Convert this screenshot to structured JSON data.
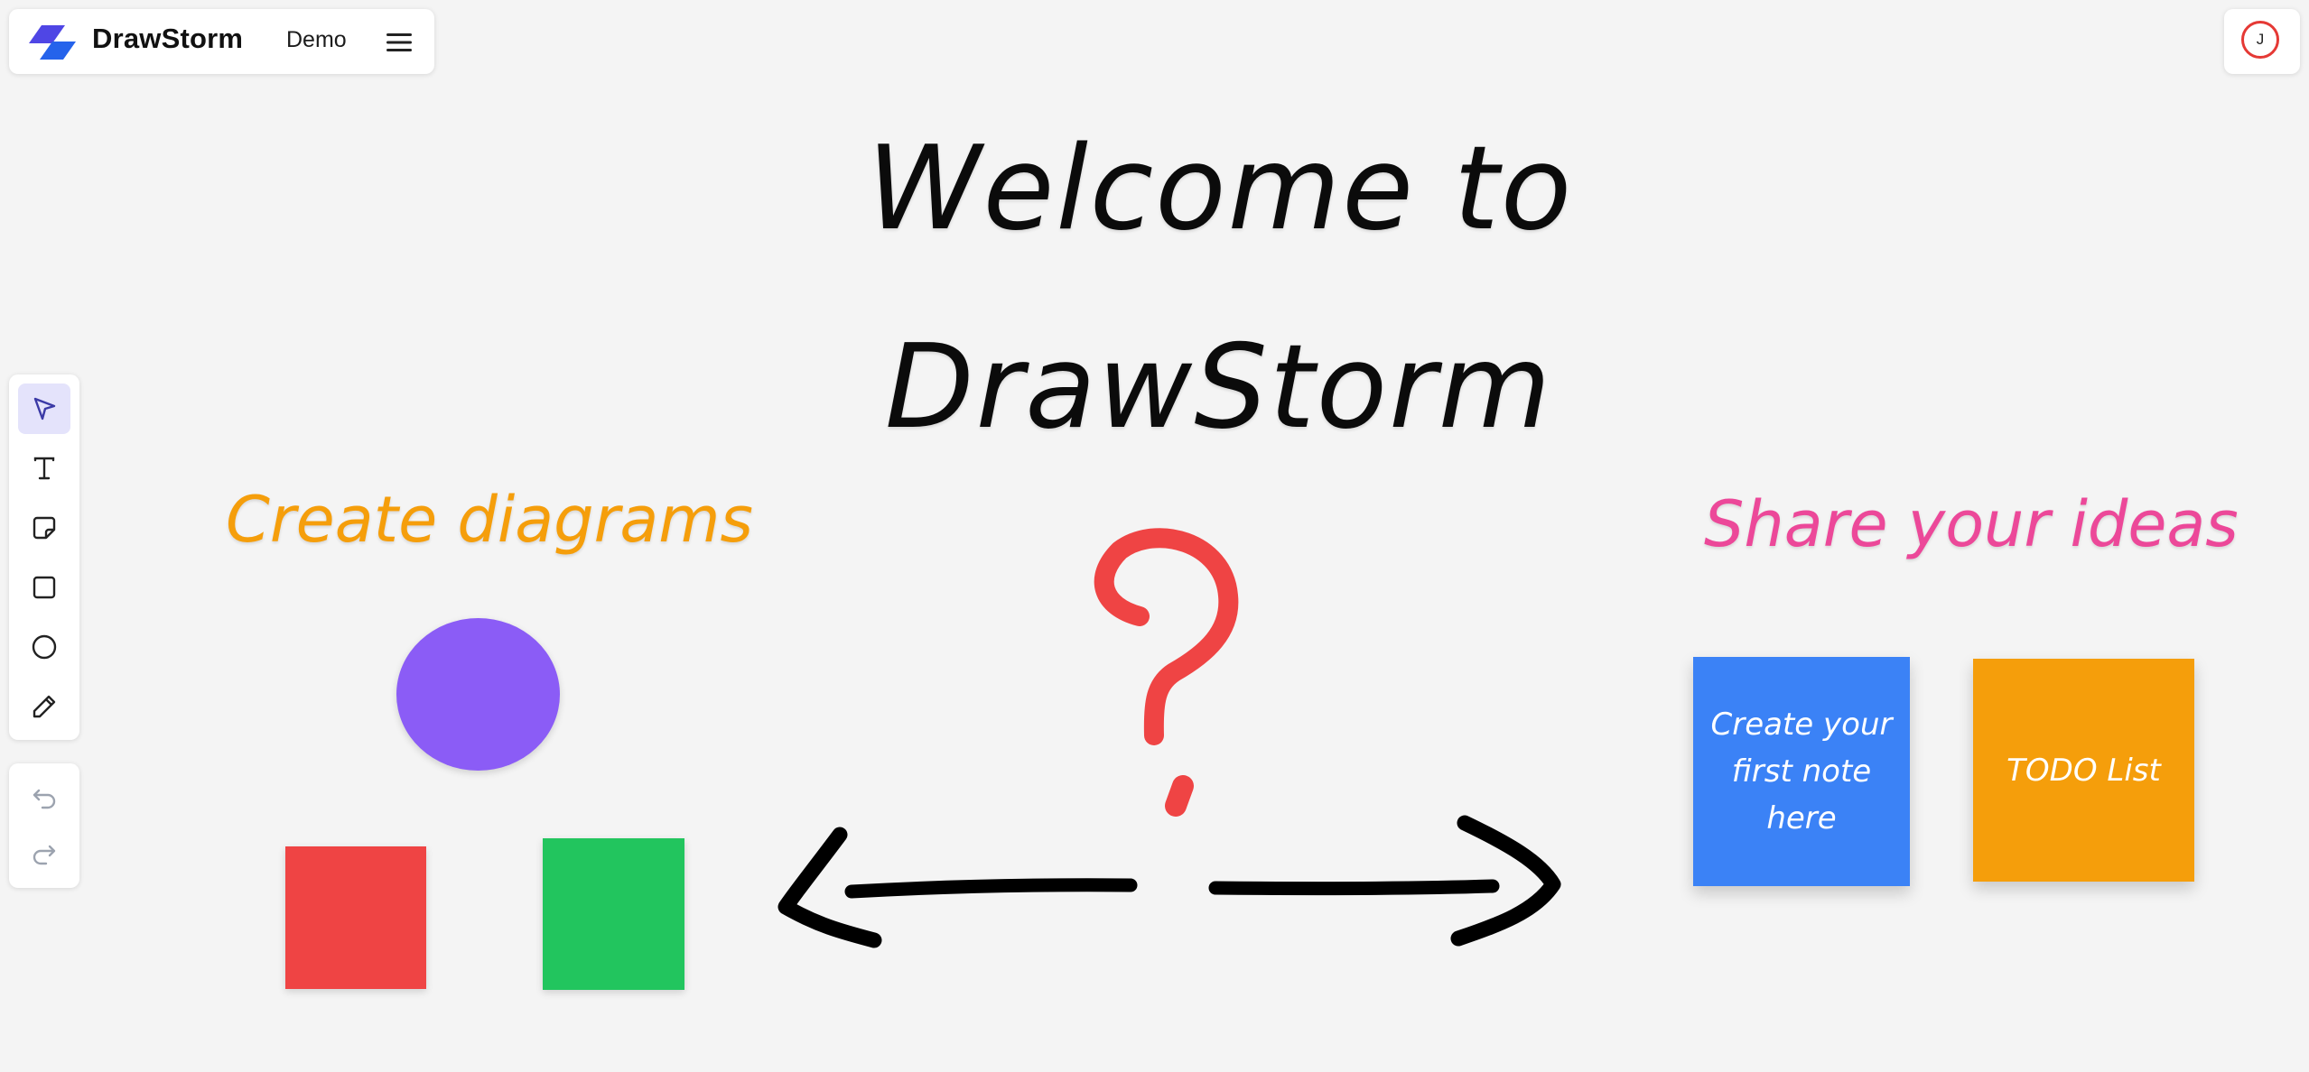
{
  "header": {
    "app_name": "DrawStorm",
    "board_name": "Demo"
  },
  "user": {
    "initial": "J"
  },
  "toolbar": {
    "tools": [
      "select",
      "text",
      "sticky-note",
      "rectangle",
      "ellipse",
      "pencil"
    ],
    "active": "select",
    "history": [
      "undo",
      "redo"
    ]
  },
  "canvas": {
    "title_line1": "Welcome to",
    "title_line2": "DrawStorm",
    "left_label": "Create diagrams",
    "right_label": "Share your ideas",
    "notes": [
      {
        "text_line1": "Create your",
        "text_line2": "first note here",
        "color": "#3b82f6"
      },
      {
        "text": "TODO List",
        "color": "#f59e0b"
      }
    ],
    "shape_colors": {
      "circle": "#8b5cf6",
      "red_square": "#ef4444",
      "green_square": "#22c55e",
      "question_mark": "#ef4444",
      "arrows": "#000000"
    }
  }
}
